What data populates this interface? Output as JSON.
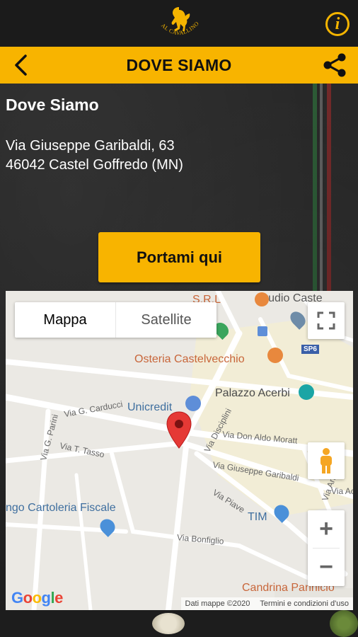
{
  "brand": {
    "logo_text": "AL CAVALLINO"
  },
  "header": {
    "title": "DOVE SIAMO"
  },
  "place": {
    "title": "Dove Siamo",
    "address_line1": "Via Giuseppe Garibaldi, 63",
    "address_line2": "46042 Castel Goffredo (MN)"
  },
  "cta": {
    "label": "Portami qui"
  },
  "map": {
    "type_options": [
      "Mappa",
      "Satellite"
    ],
    "selected_type": "Mappa",
    "pois": {
      "studio": "Studio Caste",
      "srl": "S.R.L",
      "osteria": "Osteria Castelvecchio",
      "palazzo": "Palazzo Acerbi",
      "unicredit": "Unicredit",
      "cartoleria": "ngo Cartoleria Fiscale",
      "tim": "TIM",
      "candrina": "Candrina Pannicio",
      "road_badge": "SP6"
    },
    "streets": {
      "carducci": "Via G. Carducci",
      "parini": "Via G. Parini",
      "tasso": "Via T. Tasso",
      "disciplini": "Via Disciplini",
      "moratti": "Via Don Aldo Moratt",
      "garibaldi": "Via Giuseppe Garibaldi",
      "piave": "Via Piave",
      "bonfiglio": "Via Bonfiglio",
      "ace": "Via Ace",
      "andr": "Via Andr"
    },
    "attribution": {
      "data": "Dati mappe ©2020",
      "terms": "Termini e condizioni d'uso"
    },
    "google_logo": "Google",
    "zoom_in": "+",
    "zoom_out": "−"
  },
  "colors": {
    "accent": "#f8b400",
    "dark": "#232323"
  }
}
